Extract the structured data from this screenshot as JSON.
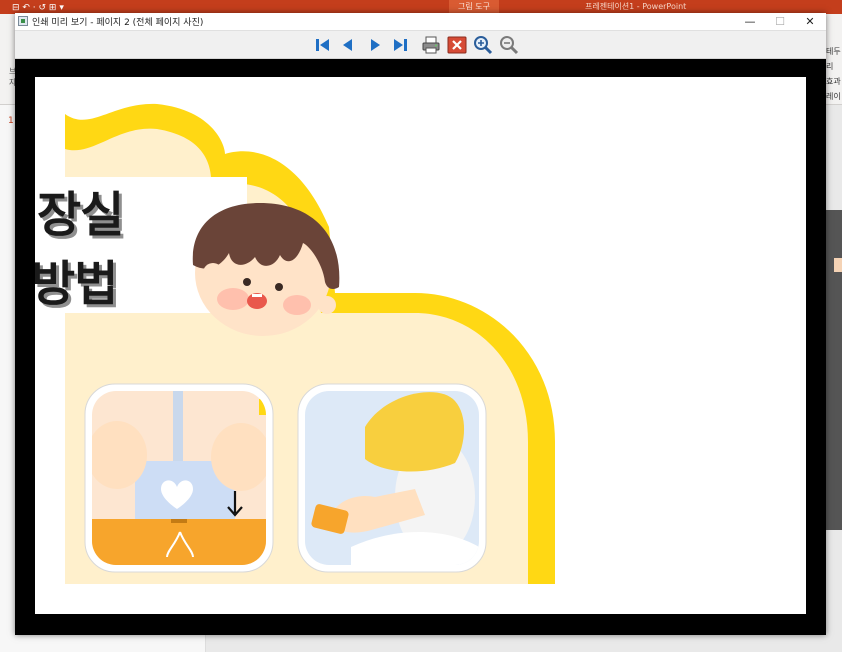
{
  "powerpoint": {
    "quick_access": "⊟ ↶ · ↺ ⊞ ▾",
    "contextual_tab": "그림 도구",
    "doc_title": "프레젠테이션1 - PowerPoint",
    "right_labels": [
      "테두리",
      "효과",
      "레이아"
    ],
    "left_labels": [
      "브",
      "자"
    ],
    "slide_number": "1"
  },
  "window": {
    "title": "인쇄 미리 보기 - 페이지 2 (전체 페이지 사진)",
    "minimize": "—",
    "maximize": "☐",
    "close": "✕"
  },
  "toolbar": {
    "buttons": [
      "first-page",
      "previous-page",
      "next-page",
      "last-page",
      "print",
      "close-preview",
      "zoom-in",
      "zoom-out"
    ]
  },
  "slide": {
    "title_line1": "장실",
    "title_line2": "방법"
  },
  "colors": {
    "accent_yellow": "#FFD814",
    "cream": "#FFF0CC",
    "powerpoint_red": "#C43E1C"
  }
}
